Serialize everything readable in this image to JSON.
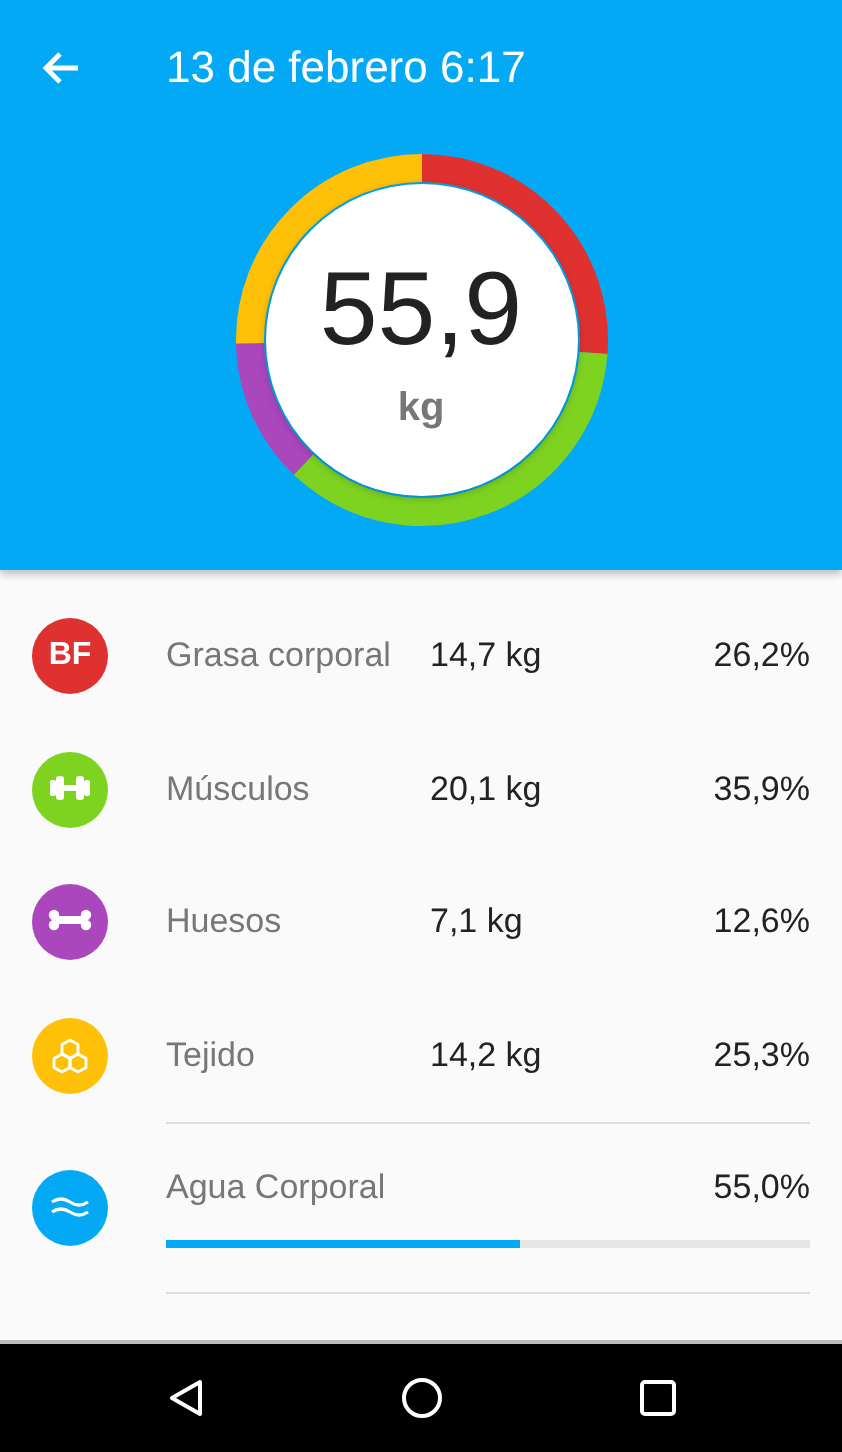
{
  "header": {
    "title": "13 de febrero 6:17"
  },
  "summary": {
    "weight": "55,9",
    "unit": "kg"
  },
  "rows": [
    {
      "kind": "fat",
      "icon_text": "BF",
      "color": "#e03131",
      "label": "Grasa corporal",
      "value": "14,7 kg",
      "percent": "26,2%"
    },
    {
      "kind": "muscle",
      "color": "#7ed321",
      "label": "Músculos",
      "value": "20,1 kg",
      "percent": "35,9%"
    },
    {
      "kind": "bone",
      "color": "#ab47bc",
      "label": "Huesos",
      "value": "7,1 kg",
      "percent": "12,6%"
    },
    {
      "kind": "tissue",
      "color": "#ffc107",
      "label": "Tejido",
      "value": "14,2 kg",
      "percent": "25,3%"
    }
  ],
  "water": {
    "label": "Agua Corporal",
    "percent": "55,0%",
    "level": 0.55,
    "color": "#03a9f4"
  }
}
